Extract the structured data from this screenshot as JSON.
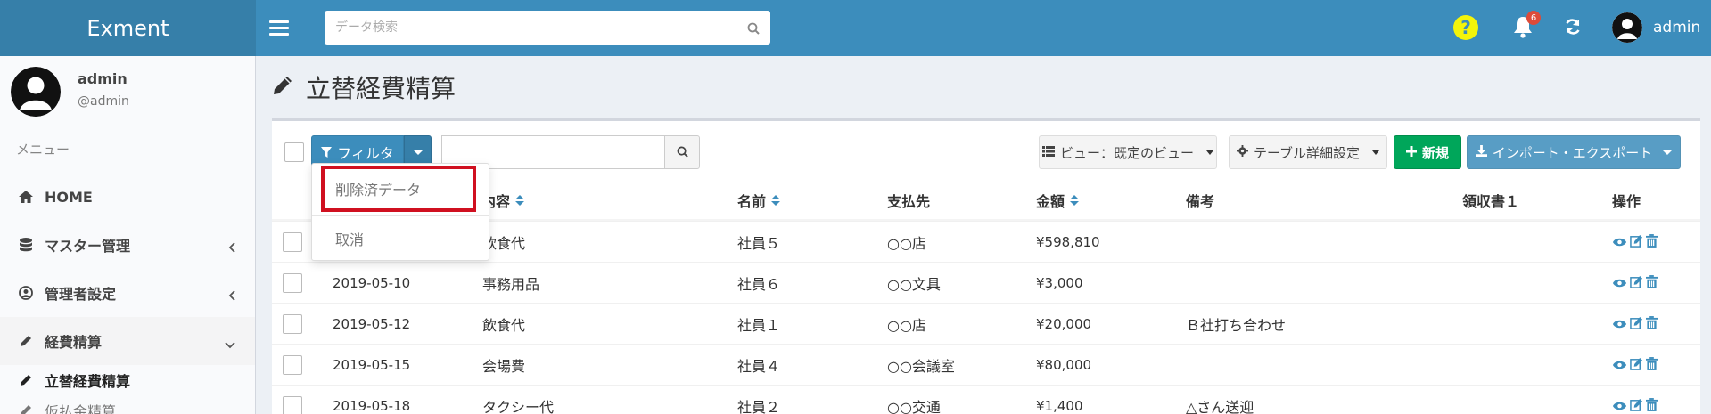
{
  "header": {
    "app_name": "Exment",
    "search_placeholder": "データ検索",
    "notification_count": "6",
    "user": "admin"
  },
  "sidebar": {
    "user_name": "admin",
    "user_handle": "@admin",
    "menu_header": "メニュー",
    "items": [
      {
        "label": "HOME",
        "icon": "home-icon"
      },
      {
        "label": "マスター管理",
        "icon": "database-icon"
      },
      {
        "label": "管理者設定",
        "icon": "user-circle-icon"
      },
      {
        "label": "経費精算",
        "icon": "pencil-icon"
      }
    ],
    "subitems": [
      {
        "label": "立替経費精算",
        "icon": "pencil-icon"
      },
      {
        "label": "仮払金精算",
        "icon": "pencil-icon"
      }
    ]
  },
  "page": {
    "title": "立替経費精算"
  },
  "toolbar": {
    "filter_label": "フィルタ",
    "view_label": "ビュー：既定のビュー",
    "table_settings_label": "テーブル詳細設定",
    "new_label": "新規",
    "import_export_label": "インポート・エクスポート"
  },
  "dropdown": {
    "items": [
      "削除済データ",
      "取消"
    ]
  },
  "table": {
    "headers": [
      "内容",
      "名前",
      "支払先",
      "金額",
      "備考",
      "領収書１",
      "操作"
    ],
    "rows": [
      {
        "date": "",
        "content": "飲食代",
        "name": "社員５",
        "payee": "○○店",
        "amount": "¥598,810",
        "note": ""
      },
      {
        "date": "2019-05-10",
        "content": "事務用品",
        "name": "社員６",
        "payee": "○○文具",
        "amount": "¥3,000",
        "note": ""
      },
      {
        "date": "2019-05-12",
        "content": "飲食代",
        "name": "社員１",
        "payee": "○○店",
        "amount": "¥20,000",
        "note": "Ｂ社打ち合わせ"
      },
      {
        "date": "2019-05-15",
        "content": "会場費",
        "name": "社員４",
        "payee": "○○会議室",
        "amount": "¥80,000",
        "note": ""
      },
      {
        "date": "2019-05-18",
        "content": "タクシー代",
        "name": "社員２",
        "payee": "○○交通",
        "amount": "¥1,400",
        "note": "△さん送迎"
      }
    ]
  },
  "colors": {
    "header_bg": "#3c8dbc",
    "logo_bg": "#367fa9",
    "success": "#00a65a",
    "highlight_border": "#d01020"
  }
}
